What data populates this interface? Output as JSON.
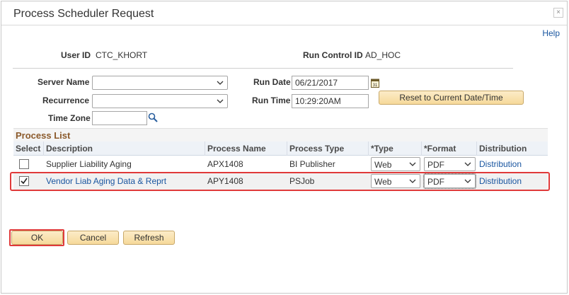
{
  "window": {
    "title": "Process Scheduler Request",
    "close_label": "×"
  },
  "help_label": "Help",
  "header": {
    "user_id_label": "User ID",
    "user_id_value": "CTC_KHORT",
    "run_control_label": "Run Control ID",
    "run_control_value": "AD_HOC"
  },
  "form": {
    "server_name_label": "Server Name",
    "server_name_value": "",
    "recurrence_label": "Recurrence",
    "recurrence_value": "",
    "time_zone_label": "Time Zone",
    "time_zone_value": "",
    "run_date_label": "Run Date",
    "run_date_value": "06/21/2017",
    "run_time_label": "Run Time",
    "run_time_value": "10:29:20AM",
    "reset_button": "Reset to Current Date/Time",
    "calendar_icon_text": "31"
  },
  "process_list": {
    "title": "Process List",
    "columns": [
      "Select",
      "Description",
      "Process Name",
      "Process Type",
      "*Type",
      "*Format",
      "Distribution"
    ],
    "rows": [
      {
        "selected": false,
        "description": "Supplier Liability Aging",
        "process_name": "APX1408",
        "process_type": "BI Publisher",
        "type": "Web",
        "format": "PDF",
        "distribution": "Distribution"
      },
      {
        "selected": true,
        "description": "Vendor Liab Aging Data & Reprt",
        "process_name": "APY1408",
        "process_type": "PSJob",
        "type": "Web",
        "format": "PDF",
        "distribution": "Distribution"
      }
    ]
  },
  "buttons": {
    "ok": "OK",
    "cancel": "Cancel",
    "refresh": "Refresh"
  },
  "icons": {
    "close": "close-icon",
    "calendar": "calendar-icon",
    "lookup": "magnifier-icon",
    "dropdown": "chevron-down-icon",
    "checkbox_checked": "checkmark-icon"
  },
  "colors": {
    "link": "#1a56a0",
    "grid_title": "#8b5a2b",
    "button_fill": "#f6d99a",
    "highlight": "#e03a3a"
  }
}
